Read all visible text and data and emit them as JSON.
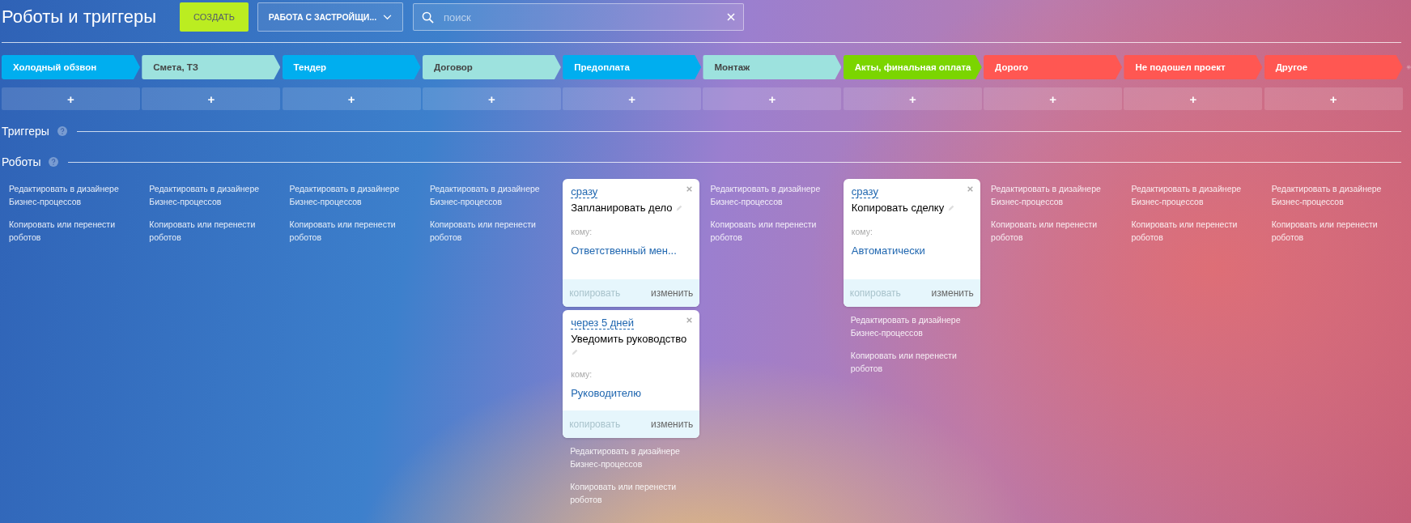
{
  "header": {
    "title": "Роботы и триггеры",
    "create_button": "СОЗДАТЬ",
    "pipeline_select": "РАБОТА С ЗАСТРОЙЩИ...",
    "search": {
      "placeholder": "поиск"
    }
  },
  "columns": [
    {
      "stage": {
        "name": "Холодный обзвон",
        "color": "#00aeef"
      },
      "add": "+",
      "links": [
        "Редактировать в дизайнере Бизнес-процессов",
        "Копировать или перенести роботов"
      ]
    },
    {
      "stage": {
        "name": "Смета, ТЗ",
        "color": "#9de2de"
      },
      "add": "+",
      "links": [
        "Редактировать в дизайнере Бизнес-процессов",
        "Копировать или перенести роботов"
      ]
    },
    {
      "stage": {
        "name": "Тендер",
        "color": "#00aeef"
      },
      "add": "+",
      "links": [
        "Редактировать в дизайнере Бизнес-процессов",
        "Копировать или перенести роботов"
      ]
    },
    {
      "stage": {
        "name": "Договор",
        "color": "#9de2de"
      },
      "add": "+",
      "links": [
        "Редактировать в дизайнере Бизнес-процессов",
        "Копировать или перенести роботов"
      ]
    },
    {
      "stage": {
        "name": "Предоплата",
        "color": "#00aeef"
      },
      "add": "+",
      "robots": [
        {
          "delay": "сразу",
          "title": "Запланировать дело",
          "to_label": "кому:",
          "to": "Ответственный мен...",
          "copy": "копировать",
          "copy_disabled": true,
          "edit": "изменить"
        },
        {
          "delay": "через 5 дней",
          "title": "Уведомить руководство",
          "to_label": "кому:",
          "to": "Руководителю",
          "copy": "копировать",
          "copy_disabled": true,
          "edit": "изменить"
        }
      ],
      "links": [
        "Редактировать в дизайнере Бизнес-процессов",
        "Копировать или перенести роботов"
      ]
    },
    {
      "stage": {
        "name": "Монтаж",
        "color": "#9de2de"
      },
      "add": "+",
      "links": [
        "Редактировать в дизайнере Бизнес-процессов",
        "Копировать или перенести роботов"
      ]
    },
    {
      "stage": {
        "name": "Акты, финальная оплата",
        "color": "#7bd500"
      },
      "add": "+",
      "robots": [
        {
          "delay": "сразу",
          "title": "Копировать сделку",
          "to_label": "кому:",
          "to": "Автоматически",
          "copy": "копировать",
          "copy_disabled": true,
          "edit": "изменить"
        }
      ],
      "links": [
        "Редактировать в дизайнере Бизнес-процессов",
        "Копировать или перенести роботов"
      ]
    },
    {
      "stage": {
        "name": "Дорого",
        "color": "#ff5752"
      },
      "add": "+",
      "links": [
        "Редактировать в дизайнере Бизнес-процессов",
        "Копировать или перенести роботов"
      ]
    },
    {
      "stage": {
        "name": "Не подошел проект",
        "color": "#ff5752"
      },
      "add": "+",
      "links": [
        "Редактировать в дизайнере Бизнес-процессов",
        "Копировать или перенести роботов"
      ]
    },
    {
      "stage": {
        "name": "Другое",
        "color": "#ff5752"
      },
      "add": "+",
      "links": [
        "Редактировать в дизайнере Бизнес-процессов",
        "Копировать или перенести роботов"
      ]
    }
  ],
  "sections": {
    "triggers": "Триггеры",
    "robots": "Роботы"
  }
}
